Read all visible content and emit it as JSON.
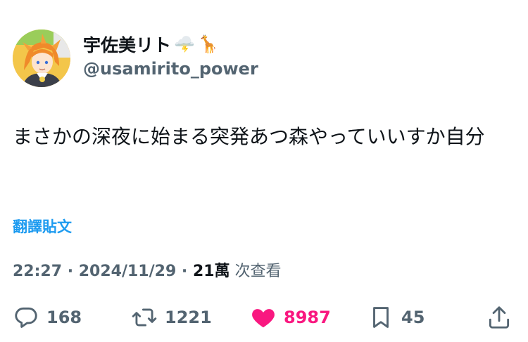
{
  "author": {
    "display_name": "宇佐美リト",
    "emojis": [
      "🌩️",
      "🦒"
    ],
    "handle": "@usamirito_power"
  },
  "tweet": {
    "text": "まさかの深夜に始まる突発あつ森やっていいすか自分"
  },
  "translate_label": "翻譯貼文",
  "meta": {
    "time": "22:27",
    "sep1": " · ",
    "date": "2024/11/29",
    "sep2": " · ",
    "views": "21萬",
    "views_label": " 次查看"
  },
  "actions": {
    "replies": "168",
    "retweets": "1221",
    "likes": "8987",
    "bookmarks": "45"
  },
  "colors": {
    "accent": "#1d9bf0",
    "like": "#f91880",
    "muted": "#536471",
    "text": "#0f1419"
  }
}
